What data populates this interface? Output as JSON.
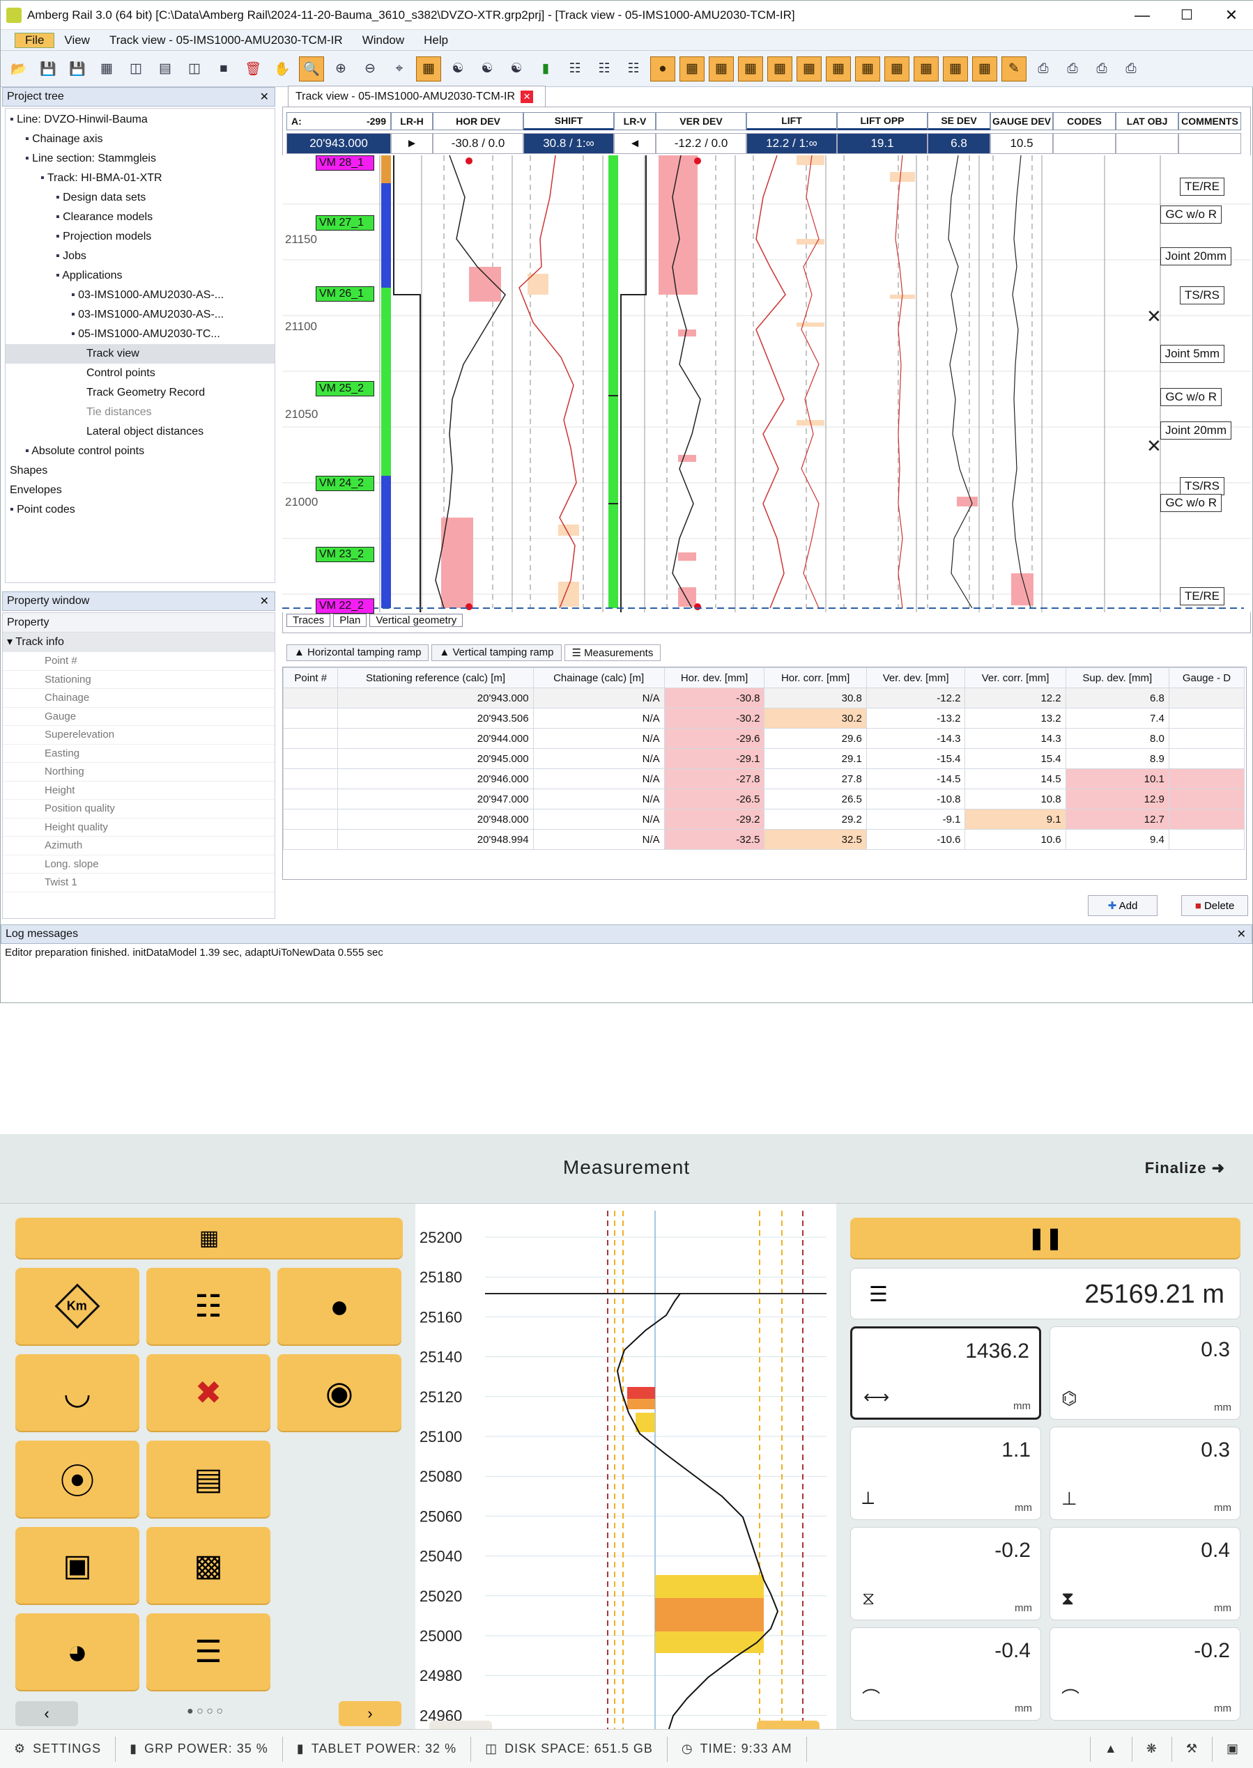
{
  "window": {
    "title": "Amberg Rail 3.0 (64 bit) [C:\\Data\\Amberg Rail\\2024-11-20-Bauma_3610_s382\\DVZO-XTR.grp2prj] - [Track view - 05-IMS1000-AMU2030-TCM-IR]"
  },
  "menu": [
    "File",
    "View",
    "Track view - 05-IMS1000-AMU2030-TCM-IR",
    "Window",
    "Help"
  ],
  "project_tree": {
    "title": "Project tree",
    "items": [
      {
        "label": "Line: DVZO-Hinwil-Bauma",
        "indent": 0,
        "icon": "rail-icon"
      },
      {
        "label": "Chainage axis",
        "indent": 1,
        "icon": "rail-icon"
      },
      {
        "label": "Line section: Stammgleis",
        "indent": 1,
        "icon": "rail-icon"
      },
      {
        "label": "Track: HI-BMA-01-XTR",
        "indent": 2,
        "icon": "rail-icon"
      },
      {
        "label": "Design data sets",
        "indent": 3,
        "icon": "folder-icon"
      },
      {
        "label": "Clearance models",
        "indent": 3,
        "icon": "cube-icon"
      },
      {
        "label": "Projection models",
        "indent": 3,
        "icon": "cube-icon"
      },
      {
        "label": "Jobs",
        "indent": 3,
        "icon": "play-icon"
      },
      {
        "label": "Applications",
        "indent": 3,
        "icon": "app-icon"
      },
      {
        "label": "03-IMS1000-AMU2030-AS-...",
        "indent": 4,
        "icon": "curve-icon"
      },
      {
        "label": "03-IMS1000-AMU2030-AS-...",
        "indent": 4,
        "icon": "rails-icon"
      },
      {
        "label": "05-IMS1000-AMU2030-TC...",
        "indent": 4,
        "icon": "rails-icon"
      },
      {
        "label": "Track view",
        "indent": 5,
        "icon": ""
      },
      {
        "label": "Control points",
        "indent": 5,
        "icon": ""
      },
      {
        "label": "Track Geometry Record",
        "indent": 5,
        "icon": ""
      },
      {
        "label": "Tie distances",
        "indent": 5,
        "icon": ""
      },
      {
        "label": "Lateral object distances",
        "indent": 5,
        "icon": ""
      },
      {
        "label": "Absolute control points",
        "indent": 1,
        "icon": "target-icon"
      },
      {
        "label": "Shapes",
        "indent": 0,
        "icon": ""
      },
      {
        "label": "Envelopes",
        "indent": 0,
        "icon": ""
      },
      {
        "label": "Point codes",
        "indent": 0,
        "icon": "table-icon"
      }
    ]
  },
  "property_window": {
    "title": "Property window",
    "header": "Property",
    "group": "Track info",
    "items": [
      "Point #",
      "Stationing",
      "Chainage",
      "Gauge",
      "Superelevation",
      "Easting",
      "Northing",
      "Height",
      "Position quality",
      "Height quality",
      "Azimuth",
      "Long. slope",
      "Twist 1"
    ]
  },
  "track_view": {
    "tab": "Track view - 05-IMS1000-AMU2030-TCM-IR",
    "a_label": "A:",
    "a_value": "-299",
    "station": "20'943.000",
    "columns": [
      {
        "label": "LR-H",
        "value": "►"
      },
      {
        "label": "HOR DEV",
        "value": "-30.8 / 0.0"
      },
      {
        "label": "SHIFT",
        "value": "30.8 / 1:∞"
      },
      {
        "label": "LR-V",
        "value": "◄"
      },
      {
        "label": "VER DEV",
        "value": "-12.2 / 0.0"
      },
      {
        "label": "LIFT",
        "value": "12.2 / 1:∞"
      },
      {
        "label": "LIFT OPP",
        "value": "19.1"
      },
      {
        "label": "SE DEV",
        "value": "6.8"
      },
      {
        "label": "GAUGE DEV",
        "value": "10.5"
      },
      {
        "label": "CODES",
        "value": ""
      },
      {
        "label": "LAT OBJ",
        "value": ""
      },
      {
        "label": "COMMENTS",
        "value": ""
      }
    ],
    "stations": [
      "21150",
      "21100",
      "21050",
      "21000"
    ],
    "vm_labels": [
      "VM 28_1",
      "VM 27_1",
      "VM 26_1",
      "VM 25_2",
      "VM 24_2",
      "VM 23_2",
      "VM 22_2"
    ],
    "comments": [
      "TE/RE",
      "GC w/o R",
      "Joint 20mm",
      "TS/RS",
      "Joint 5mm",
      "GC w/o R",
      "Joint 20mm",
      "TS/RS",
      "GC w/o R",
      "TE/RE"
    ],
    "bottom_tabs": [
      "Traces",
      "Plan",
      "Vertical geometry"
    ]
  },
  "measure_panel": {
    "tabs": [
      "Horizontal tamping ramp",
      "Vertical tamping ramp",
      "Measurements"
    ],
    "headers": [
      "Point #",
      "Stationing reference (calc) [m]",
      "Chainage (calc) [m]",
      "Hor. dev. [mm]",
      "Hor. corr. [mm]",
      "Ver. dev. [mm]",
      "Ver. corr. [mm]",
      "Sup. dev. [mm]",
      "Gauge - D"
    ],
    "rows": [
      [
        "",
        "20'943.000",
        "N/A",
        "-30.8",
        "30.8",
        "-12.2",
        "12.2",
        "6.8"
      ],
      [
        "",
        "20'943.506",
        "N/A",
        "-30.2",
        "30.2",
        "-13.2",
        "13.2",
        "7.4"
      ],
      [
        "",
        "20'944.000",
        "N/A",
        "-29.6",
        "29.6",
        "-14.3",
        "14.3",
        "8.0"
      ],
      [
        "",
        "20'945.000",
        "N/A",
        "-29.1",
        "29.1",
        "-15.4",
        "15.4",
        "8.9"
      ],
      [
        "",
        "20'946.000",
        "N/A",
        "-27.8",
        "27.8",
        "-14.5",
        "14.5",
        "10.1"
      ],
      [
        "",
        "20'947.000",
        "N/A",
        "-26.5",
        "26.5",
        "-10.8",
        "10.8",
        "12.9"
      ],
      [
        "",
        "20'948.000",
        "N/A",
        "-29.2",
        "29.2",
        "-9.1",
        "9.1",
        "12.7"
      ],
      [
        "",
        "20'948.994",
        "N/A",
        "-32.5",
        "32.5",
        "-10.6",
        "10.6",
        "9.4"
      ]
    ],
    "add": "Add",
    "delete": "Delete"
  },
  "log": {
    "title": "Log messages",
    "text": "Editor preparation finished. initDataModel 1.39 sec, adaptUiToNewData 0.555 sec"
  },
  "tablet": {
    "title": "Measurement",
    "finalize": "Finalize",
    "chainage": "25169.21 m",
    "axis": [
      "25200",
      "25180",
      "25160",
      "25140",
      "25120",
      "25100",
      "25080",
      "25060",
      "25040",
      "25020",
      "25000",
      "24980",
      "24960"
    ],
    "readings": [
      {
        "value": "1436.2",
        "unit": "mm",
        "icon": "gauge-icon"
      },
      {
        "value": "0.3",
        "unit": "mm",
        "icon": "cant-icon"
      },
      {
        "value": "1.1",
        "unit": "mm",
        "icon": "twist-icon"
      },
      {
        "value": "0.3",
        "unit": "mm",
        "icon": "level-icon"
      },
      {
        "value": "-0.2",
        "unit": "mm",
        "icon": "align-left-icon"
      },
      {
        "value": "0.4",
        "unit": "mm",
        "icon": "align-right-icon"
      },
      {
        "value": "-0.4",
        "unit": "mm",
        "icon": "vert-left-icon"
      },
      {
        "value": "-0.2",
        "unit": "mm",
        "icon": "vert-right-icon"
      }
    ],
    "status": {
      "settings": "SETTINGS",
      "grp": "GRP POWER: 35 %",
      "tablet": "TABLET POWER: 32 %",
      "disk": "DISK SPACE: 651.5 GB",
      "time": "TIME: 9:33 AM"
    }
  }
}
